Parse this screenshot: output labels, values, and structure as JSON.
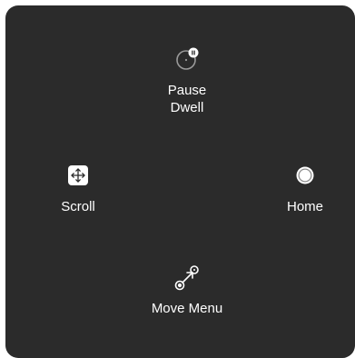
{
  "menu": {
    "pause_dwell": {
      "label": "Pause\nDwell",
      "icon": "pause-dwell-icon"
    },
    "scroll": {
      "label": "Scroll",
      "icon": "scroll-icon"
    },
    "home": {
      "label": "Home",
      "icon": "home-icon"
    },
    "move_menu": {
      "label": "Move Menu",
      "icon": "move-menu-icon"
    }
  },
  "colors": {
    "panel_background": "#2b2b2b",
    "text": "#ffffff",
    "icon_muted": "#9a9a9a"
  }
}
